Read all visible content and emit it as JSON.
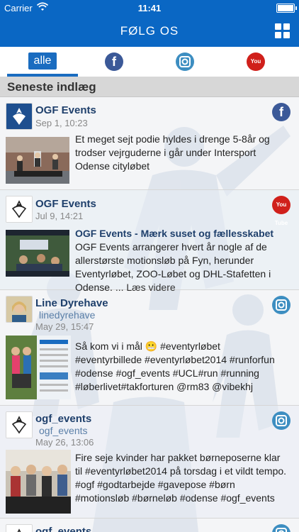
{
  "status_bar": {
    "carrier": "Carrier",
    "time": "11:41"
  },
  "nav": {
    "title": "FØLG OS"
  },
  "tabs": [
    {
      "label": "alle",
      "selected": true
    },
    {
      "icon": "facebook-icon"
    },
    {
      "icon": "instagram-icon"
    },
    {
      "icon": "youtube-icon",
      "text": "You Tube"
    }
  ],
  "section": {
    "title": "Seneste indlæg"
  },
  "posts": [
    {
      "author": "OGF Events",
      "date": "Sep 1, 10:23",
      "source": "facebook",
      "text": "Et meget sejt podie hyldes i drenge 5-8år og trodser vejrguderne i går under Intersport Odense cityløbet"
    },
    {
      "author": "OGF Events",
      "date": "Jul 9, 14:21",
      "source": "youtube",
      "title": "OGF Events - Mærk suset og fællesskabet",
      "text": "OGF Events arrangerer hvert år nogle af de allerstørste motionsløb på Fyn, herunder Eventyrløbet, ZOO-Løbet og DHL-Stafetten i Odense.",
      "read_more": "... Læs videre"
    },
    {
      "author": "Line Dyrehave",
      "handle": "linedyrehave",
      "date": "May 29, 15:47",
      "source": "instagram",
      "text": "Så kom vi i mål 😬 #eventyrløbet #eventyrbillede #eventyrløbet2014 #runforfun #odense #ogf_events #UCL#run #running #løberlivet#takforturen @rm83 @vibekhj"
    },
    {
      "author": "ogf_events",
      "handle": "ogf_events",
      "date": "May 26, 13:06",
      "source": "instagram",
      "text": "Fire seje kvinder har pakket børneposerne klar til #eventyrløbet2014 på torsdag i et vildt tempo. #ogf #godtarbejde #gavepose #børn #motionsløb #børneløb #odense #ogf_events"
    },
    {
      "author": "ogf_events",
      "source": "instagram"
    }
  ],
  "colors": {
    "brand": "#0a67c4",
    "facebook": "#3b5998",
    "instagram": "#3d8ec1",
    "youtube": "#d0201b"
  }
}
